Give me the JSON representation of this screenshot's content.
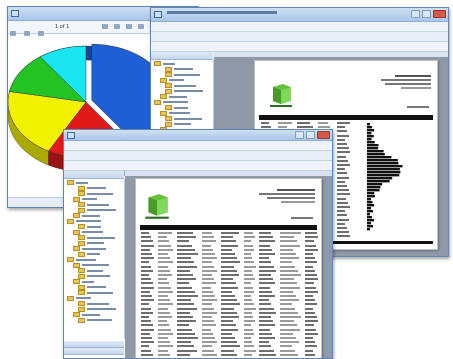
{
  "windows": {
    "chart_viewer": {
      "toolbar": {
        "page_indicator": "1 of 1"
      },
      "chart_data": {
        "type": "pie",
        "title": "",
        "categories": [
          "blue",
          "red",
          "yellow",
          "green",
          "cyan"
        ],
        "values": [
          40,
          18,
          20,
          12,
          10
        ],
        "colors": [
          "#1f5fd6",
          "#e01919",
          "#f2f200",
          "#22c322",
          "#18e6f2"
        ]
      }
    },
    "report_viewer_back": {},
    "report_viewer_front": {}
  },
  "colors": {
    "title_bar": "#b8d0ee",
    "report_header_bar": "#111111",
    "logo_green": "#63c13a",
    "histogram": "#111111"
  }
}
